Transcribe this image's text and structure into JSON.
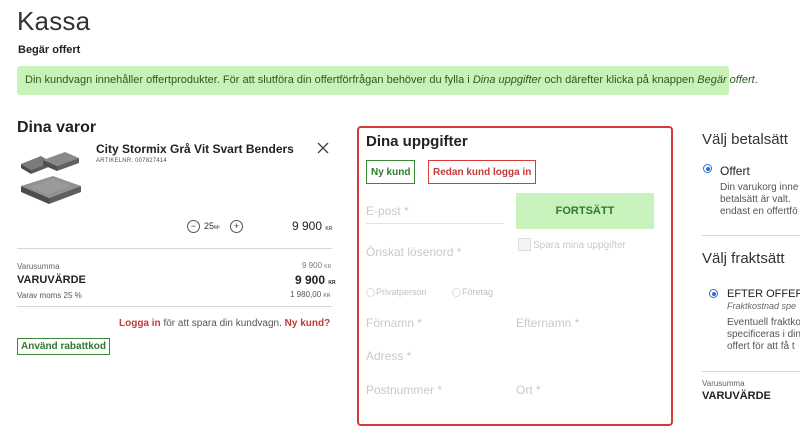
{
  "page": {
    "title": "Kassa",
    "subtitle": "Begär offert"
  },
  "notice": {
    "text_1": "Din kundvagn innehåller offertprodukter. För att slutföra din offertförfrågan behöver du fylla i ",
    "em_1": "Dina uppgifter",
    "text_2": " och därefter klicka på knappen ",
    "em_2": "Begär offert",
    "text_3": "."
  },
  "cart": {
    "heading": "Dina varor",
    "product": {
      "name": "City Stormix Grå Vit Svart Benders",
      "article": "ARTIKELNR: 007827414",
      "quantity": "25",
      "quantity_unit": "M²",
      "price": "9 900",
      "currency": "KR",
      "image_icon": "paving-stones-image"
    },
    "summary": {
      "sum_label": "Varusumma",
      "sum_value": "9 900",
      "varuvarde_label": "VARUVÄRDE",
      "varuvarde_value": "9 900",
      "moms_label": "Varav moms 25 %",
      "moms_value": "1 980,00",
      "currency": "KR"
    },
    "login_prompt": {
      "login_link": "Logga in",
      "middle_text": " för att spara din kundvagn. ",
      "new_link": "Ny kund?"
    },
    "discount_button": "Använd rabattkod"
  },
  "form": {
    "heading": "Dina uppgifter",
    "new_customer_button": "Ny kund",
    "existing_customer_button": "Redan kund logga in",
    "email_placeholder": "E-post *",
    "continue_button": "FORTSÄTT",
    "save_label": "Spara mina uppgifter",
    "password_placeholder": "Önskat lösenord *",
    "private_label": "Privatperson",
    "company_label": "Företag",
    "firstname_placeholder": "Förnamn *",
    "lastname_placeholder": "Efternamn *",
    "address_placeholder": "Adress *",
    "postcode_placeholder": "Postnummer *",
    "city_placeholder": "Ort *"
  },
  "payment": {
    "heading": "Välj betalsätt",
    "option_label": "Offert",
    "desc_line1": "Din varukorg inne",
    "desc_line2": "betalsätt är valt.",
    "desc_line3": "endast en offertfö"
  },
  "shipping": {
    "heading": "Välj fraktsätt",
    "option_label": "EFTER OFFERT",
    "option_sub": "Fraktkostnad spe",
    "desc_line1": "Eventuell fraktko",
    "desc_line2": "specificeras i din",
    "desc_line3": "offert för att få t"
  },
  "right_summary": {
    "sum_label": "Varusumma",
    "varuvarde_label": "VARUVÄRDE"
  },
  "colors": {
    "green_bg": "#c9f2b8",
    "green": "#2e7a2e",
    "red": "#d63b3b",
    "blue": "#2a6fc9"
  }
}
